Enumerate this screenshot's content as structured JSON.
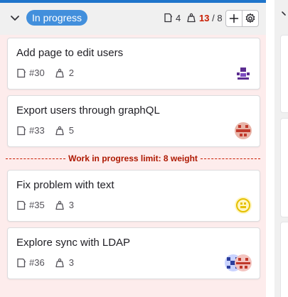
{
  "list": {
    "label": "In progress",
    "issue_count": "4",
    "weight_current": "13",
    "weight_sep": " / ",
    "weight_limit": "8",
    "icons": {
      "collapse": "chevron-down-icon",
      "issues": "issues-icon",
      "weight": "weight-icon",
      "add": "plus-icon",
      "settings": "gear-icon"
    }
  },
  "wip_limit_text": "Work in progress limit: 8 weight",
  "cards": [
    {
      "title": "Add page to edit users",
      "ref": "#30",
      "weight": "2",
      "avatar_color": "#5c2d91"
    },
    {
      "title": "Export users through graphQL",
      "ref": "#33",
      "weight": "5",
      "avatar_color": "#c0392b"
    },
    {
      "title": "Fix problem with text",
      "ref": "#35",
      "weight": "3",
      "avatar_color": "#e5c000"
    },
    {
      "title": "Explore sync with LDAP",
      "ref": "#36",
      "weight": "3",
      "avatar_color": "#2c3e9c"
    }
  ],
  "colors": {
    "accent": "#1f75cb",
    "label": "#428fdc",
    "over_limit": "#c91c00",
    "list_bg": "#fdecec"
  }
}
